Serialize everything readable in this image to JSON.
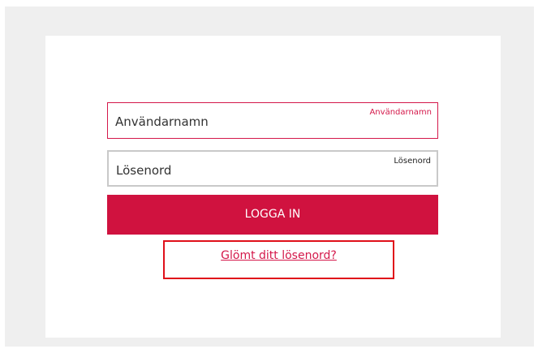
{
  "login_form": {
    "username": {
      "value": "Användarnamn",
      "floating_label": "Användarnamn"
    },
    "password": {
      "value": "Lösenord",
      "floating_label": "Lösenord"
    },
    "login_button_label": "LOGGA IN",
    "forgot_password_label": "Glömt ditt lösenord?"
  },
  "colors": {
    "accent": "#d0123f",
    "highlight_border": "#e0101a",
    "page_background": "#efefef"
  }
}
